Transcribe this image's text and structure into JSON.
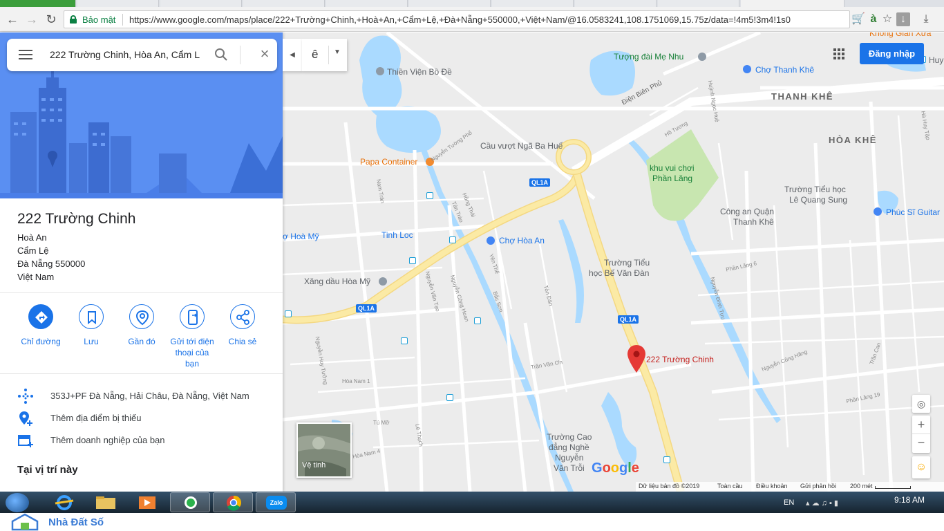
{
  "browser": {
    "secure_label": "Bảo mật",
    "url": "https://www.google.com/maps/place/222+Trường+Chinh,+Hoà+An,+Cẩm+Lệ,+Đà+Nẵng+550000,+Việt+Nam/@16.0583241,108.1751069,15.75z/data=!4m5!3m4!1s0"
  },
  "search": {
    "value": "222 Trường Chinh, Hòa An, Cẩm L"
  },
  "lang_toggle": {
    "value": "ê"
  },
  "place": {
    "title": "222 Trường Chinh",
    "address_lines": [
      "Hoà An",
      "Cẩm Lệ",
      "Đà Nẵng 550000",
      "Việt Nam"
    ]
  },
  "actions": [
    {
      "label": "Chỉ đường"
    },
    {
      "label": "Lưu"
    },
    {
      "label": "Gần đó"
    },
    {
      "label": "Gửi tới điện thoại của bạn"
    },
    {
      "label": "Chia sẻ"
    }
  ],
  "info": {
    "plus_code": "353J+PF Đà Nẵng, Hải Châu, Đà Nẵng, Việt Nam",
    "add_missing_place": "Thêm địa điểm bị thiếu",
    "add_business": "Thêm doanh nghiệp của bạn",
    "section_heading": "Tại vị trí này"
  },
  "map": {
    "signin": "Đăng nhập",
    "satellite_label": "Vệ tinh",
    "marker_label": "222 Trường Chinh",
    "logo": "Google",
    "footer": {
      "data": "Dữ liệu bản đồ ©2019",
      "global": "Toàn cầu",
      "terms": "Điều khoản",
      "feedback": "Gửi phản hồi",
      "scale": "200 mét"
    },
    "districts": [
      "THANH KHÊ",
      "HÒA KHÊ"
    ],
    "pois": {
      "tuong_dai": "Tượng đài Mẹ Nhu",
      "thien_vien": "Thiền Viện Bồ Đề",
      "cho_thanh_khe": "Chợ Thanh Khê",
      "cau_vuot": "Cầu vượt Ngã Ba Huế",
      "papa": "Papa Container",
      "khu_vui_choi": "khu vui chơi",
      "phan_lang": "Phần Lăng",
      "truong_le_quang_sung_1": "Trường Tiểu học",
      "truong_le_quang_sung_2": "Lê Quang Sung",
      "cong_an_1": "Công an Quận",
      "cong_an_2": "Thanh Khê",
      "phuc_si": "Phúc Sĩ Guitar",
      "tinh_loc": "Tinh Loc",
      "cho_hoa_an": "Chợ Hòa An",
      "cho_hoa_my": "ợ Hoà Mỹ",
      "xang_dau": "Xăng dầu Hòa Mỹ",
      "truong_be_van_dan_1": "Trường Tiểu",
      "truong_be_van_dan_2": "học Bế Văn Đàn",
      "cao_dang_1": "Trường Cao",
      "cao_dang_2": "đẳng Nghề",
      "cao_dang_3": "Nguyễn",
      "cao_dang_4": "Văn Trỗi",
      "khong_gian": "Không Gian Xưa",
      "huy_partial": "Huy"
    },
    "streets": {
      "dien_bien_phu": "Điện Biên Phủ",
      "ql1a": "QL1A",
      "nguyen_tuong_pho": "Nguyễn Tường Phổ",
      "hong_thai": "Hồng Thái",
      "tan_trao": "Tân Trào",
      "yen_the": "Yên Thế",
      "bac_son": "Bắc Sơn",
      "nguyen_cong_hoan": "Nguyễn Công Hoan",
      "nguyen_van_tao": "Nguyễn Văn Tạo",
      "ton_dan": "Tôn Đản",
      "tran_van_on": "Trần Văn Ơn",
      "nam_tran": "Nam Trân",
      "huynh_ngoc_hue": "Huỳnh Ngọc Huệ",
      "ho_tuong": "Hồ Tương",
      "nguyen_dinh_tuu": "Nguyễn Đình Tựu",
      "nguyen_cong_hang": "Nguyễn Công Hãng",
      "phan_lang_6": "Phần Lăng 6",
      "phan_lang_19": "Phần Lăng 19",
      "hoa_nam_1": "Hòa Nam 1",
      "hoa_nam_4": "Hòa Nam 4",
      "tu_mo": "Tú Mỡ",
      "le_thach": "Lê Thạch",
      "nguyen_huy_tuong": "Nguyễn Huy Tưởng",
      "ha_huy": "Hà Huy Tập",
      "tran_can": "Trần Can"
    }
  },
  "taskbar": {
    "lang": "EN",
    "time": "9:18 AM",
    "zalo": "Zalo"
  },
  "watermark": {
    "text": "Nhà Đất Số"
  },
  "colors": {
    "accent": "#1a73e8",
    "road_major": "#f9e79c",
    "water": "#aadaff",
    "park": "#c8e6b0",
    "marker": "#e53935"
  }
}
